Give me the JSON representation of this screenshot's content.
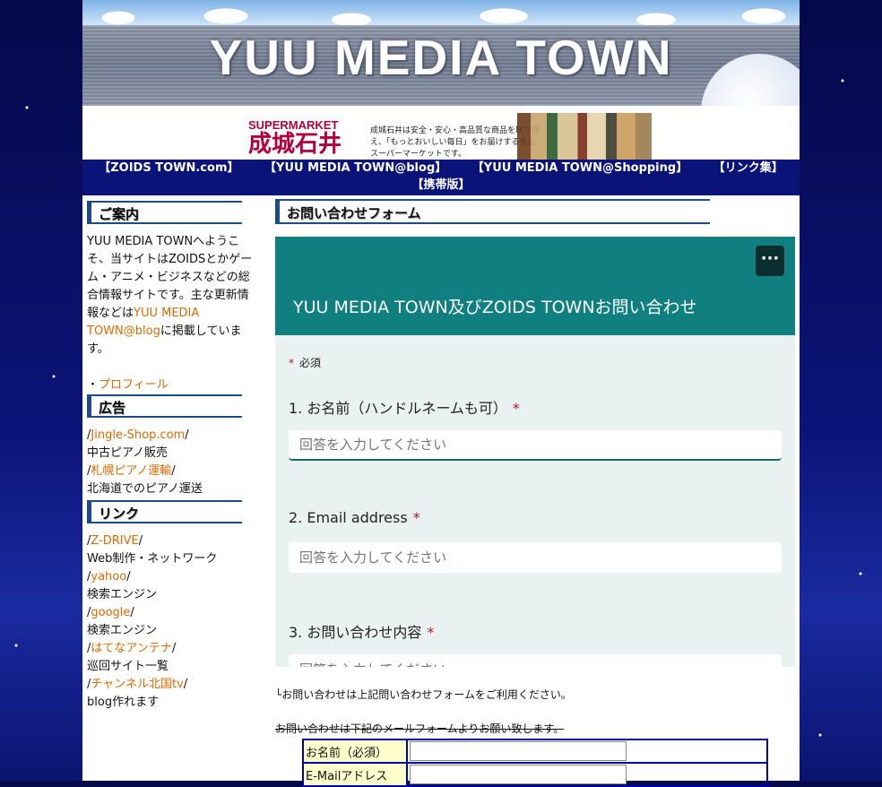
{
  "site": {
    "title": "YUU MEDIA TOWN"
  },
  "ad": {
    "logo_top": "SUPERMARKET",
    "logo_name": "成城石井",
    "text": "成城石井は安全・安心・高品質な商品を取り揃え、「もっとおいしい毎日」をお届けする食品スーパーマーケットです。"
  },
  "nav": {
    "items": [
      "【ZOIDS TOWN.com】",
      "【YUU MEDIA TOWN@blog】",
      "【YUU MEDIA TOWN@Shopping】",
      "【リンク集】",
      "【携帯版】"
    ]
  },
  "sidebar": {
    "guide_heading": "ご案内",
    "guide_text_1": "YUU MEDIA TOWNへようこそ、当サイトはZOIDSとかゲーム・アニメ・ビジネスなどの総合情報サイトです。主な更新情報などは",
    "guide_link": "YUU MEDIA TOWN@blog",
    "guide_text_2": "に掲載しています。",
    "profile_bullet": "・",
    "profile_link": "プロフィール",
    "ads_heading": "広告",
    "ads": [
      {
        "link": "Jingle-Shop.com",
        "desc": "中古ピアノ販売"
      },
      {
        "link": "札幌ピアノ運輸",
        "desc": "北海道でのピアノ運送"
      }
    ],
    "links_heading": "リンク",
    "links": [
      {
        "link": "Z-DRIVE",
        "desc": "Web制作・ネットワーク"
      },
      {
        "link": "yahoo",
        "desc": "検索エンジン"
      },
      {
        "link": "google",
        "desc": "検索エンジン"
      },
      {
        "link": "はてなアンテナ",
        "desc": "巡回サイト一覧"
      },
      {
        "link": "チャンネル北国tv",
        "desc": "blog作れます"
      }
    ],
    "slash": "/"
  },
  "main": {
    "heading": "お問い合わせフォーム",
    "form": {
      "more": "···",
      "title": "YUU MEDIA TOWN及びZOIDS TOWNお問い合わせ",
      "required_note": "必須",
      "star": "*",
      "q1": "1. お名前（ハンドルネームも可）",
      "q2": "2. Email address",
      "q3": "3. お問い合わせ内容",
      "placeholder": "回答を入力してください"
    },
    "note": "└お問い合わせは上記問い合わせフォームをご利用ください。",
    "note2": "お問い合わせは下記のメールフォームよりお願い致します。",
    "table": {
      "name_label": "お名前（必須）",
      "email_label": "E-Mailアドレス"
    }
  }
}
